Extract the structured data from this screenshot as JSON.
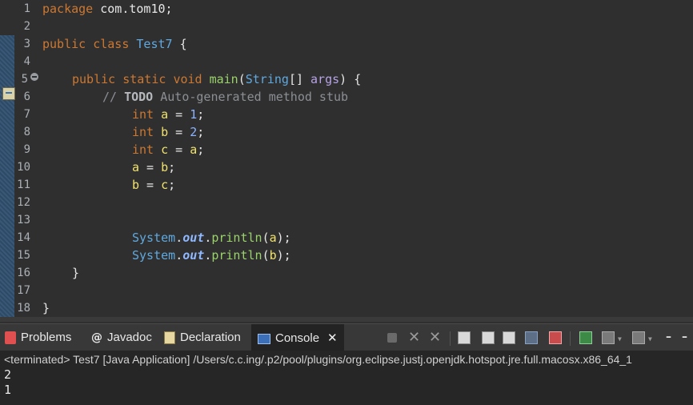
{
  "editor": {
    "lines": [
      {
        "n": "1"
      },
      {
        "n": "2"
      },
      {
        "n": "3"
      },
      {
        "n": "4"
      },
      {
        "n": "5"
      },
      {
        "n": "6"
      },
      {
        "n": "7"
      },
      {
        "n": "8"
      },
      {
        "n": "9"
      },
      {
        "n": "10"
      },
      {
        "n": "11"
      },
      {
        "n": "12"
      },
      {
        "n": "13"
      },
      {
        "n": "14"
      },
      {
        "n": "15"
      },
      {
        "n": "16"
      },
      {
        "n": "17"
      },
      {
        "n": "18"
      }
    ],
    "tokens": {
      "package_kw": "package",
      "package_name": "com.tom10;",
      "public1": "public",
      "class_kw": "class",
      "class_name": "Test7",
      "open_brace": "{",
      "public2": "public",
      "static_kw": "static",
      "void_kw": "void",
      "main_fn": "main",
      "paren_open": "(",
      "string_type": "String",
      "array_brackets": "[]",
      "args_param": "args",
      "paren_close_brace": ") {",
      "comment_prefix": "// ",
      "todo": "TODO",
      "comment_text": " Auto-generated method stub",
      "int_kw": "int",
      "var_a": "a",
      "var_b": "b",
      "var_c": "c",
      "eq": " = ",
      "val_1": "1",
      "val_2": "2",
      "semi": ";",
      "system": "System",
      "dot": ".",
      "out_field": "out",
      "println": "println",
      "lparen": "(",
      "rparen_semi": ");",
      "close_method": "}",
      "close_class": "}"
    }
  },
  "views": {
    "tabs": [
      {
        "label": "Problems"
      },
      {
        "label": "Javadoc"
      },
      {
        "label": "Declaration"
      },
      {
        "label": "Console"
      }
    ],
    "javadoc_symbol": "@"
  },
  "console": {
    "status": "<terminated> Test7 [Java Application] /Users/c.c.ing/.p2/pool/plugins/org.eclipse.justj.openjdk.hotspot.jre.full.macosx.x86_64_1",
    "output": [
      "2",
      "1"
    ]
  },
  "colors": {
    "keyword": "#cc7832",
    "type": "#5fa9e0",
    "method": "#9bd36b",
    "variable": "#f1e26f",
    "parameter": "#b7a3e6",
    "number": "#8ab4ff",
    "comment": "#8b8f94",
    "background": "#2f2f2f"
  }
}
